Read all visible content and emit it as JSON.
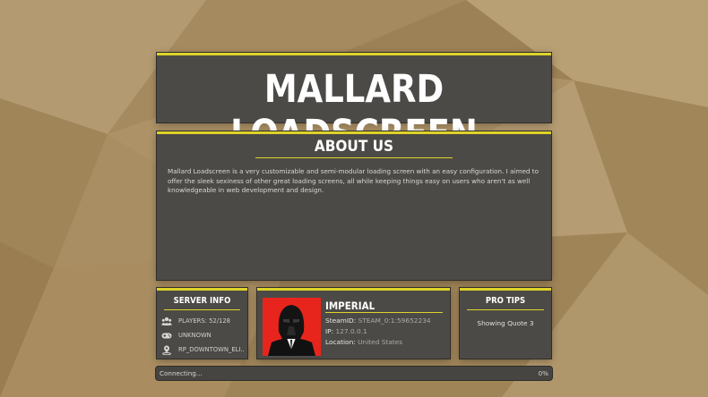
{
  "title": "MALLARD LOADSCREEN",
  "about": {
    "heading": "ABOUT US",
    "text": "Mallard Loadscreen is a very customizable and semi-modular loading screen with an easy configuration. I aimed to offer the sleek sexiness of other great loading screens, all while keeping things easy on users who aren't as well knowledgeable in web development and design."
  },
  "server_info": {
    "heading": "SERVER INFO",
    "players": "PLAYERS: 52/128",
    "gamemode": "UNKNOWN",
    "map": "RP_DOWNTOWN_ELI..."
  },
  "player": {
    "name": "IMPERIAL",
    "steamid_label": "SteamID:",
    "steamid": "STEAM_0:1:59652234",
    "ip_label": "IP:",
    "ip": "127.0.0.1",
    "location_label": "Location:",
    "location": "United States"
  },
  "pro_tips": {
    "heading": "PRO TIPS",
    "text": "Showing Quote 3"
  },
  "progress": {
    "status": "Connecting...",
    "percent_label": "0%",
    "fraction": 0
  },
  "colors": {
    "accent": "#ded32a",
    "panel": "#4c4a46",
    "background": "#a98e63",
    "avatar_bg": "#e8251c"
  },
  "icons": {
    "players": "users-icon",
    "gamemode": "gamepad-icon",
    "map": "map-marker-icon"
  }
}
